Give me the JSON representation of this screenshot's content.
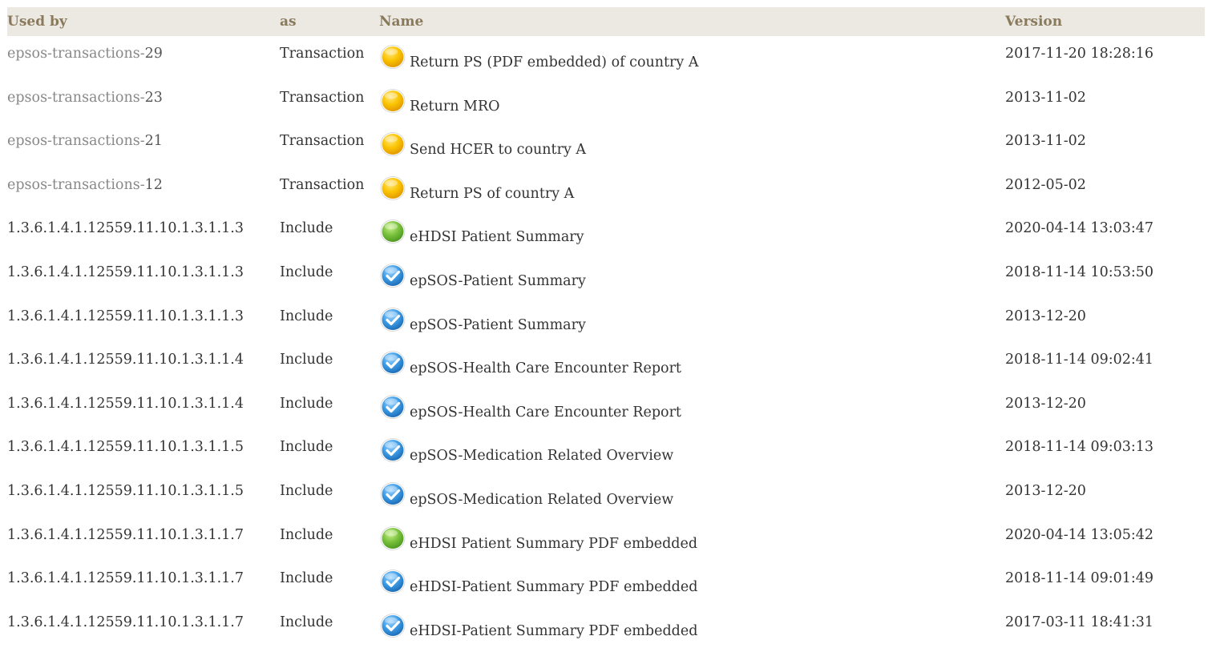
{
  "columns": {
    "used_by": "Used by",
    "as": "as",
    "name": "Name",
    "version": "Version"
  },
  "colors": {
    "header_bg": "#ece9e2",
    "header_text": "#8a7a5c",
    "link_text": "#888888",
    "status_draft": "#f7b500",
    "status_active": "#6fba3b",
    "status_final": "#3a9ee8"
  },
  "rows": [
    {
      "used_by_prefix": "epsos-transactions-",
      "used_by_num": "29",
      "as": "Transaction",
      "status_icon": "draft-status-icon",
      "name": "Return PS (PDF embedded) of country A",
      "version": "2017-11-20 18:28:16"
    },
    {
      "used_by_prefix": "epsos-transactions-",
      "used_by_num": "23",
      "as": "Transaction",
      "status_icon": "draft-status-icon",
      "name": "Return MRO",
      "version": "2013-11-02"
    },
    {
      "used_by_prefix": "epsos-transactions-",
      "used_by_num": "21",
      "as": "Transaction",
      "status_icon": "draft-status-icon",
      "name": "Send HCER to country A",
      "version": "2013-11-02"
    },
    {
      "used_by_prefix": "epsos-transactions-",
      "used_by_num": "12",
      "as": "Transaction",
      "status_icon": "draft-status-icon",
      "name": "Return PS of country A",
      "version": "2012-05-02"
    },
    {
      "used_by": "1.3.6.1.4.1.12559.11.10.1.3.1.1.3",
      "as": "Include",
      "status_icon": "active-status-icon",
      "name": "eHDSI Patient Summary",
      "version": "2020-04-14 13:03:47"
    },
    {
      "used_by": "1.3.6.1.4.1.12559.11.10.1.3.1.1.3",
      "as": "Include",
      "status_icon": "final-check-icon",
      "name": "epSOS-Patient Summary",
      "version": "2018-11-14 10:53:50"
    },
    {
      "used_by": "1.3.6.1.4.1.12559.11.10.1.3.1.1.3",
      "as": "Include",
      "status_icon": "final-check-icon",
      "name": "epSOS-Patient Summary",
      "version": "2013-12-20"
    },
    {
      "used_by": "1.3.6.1.4.1.12559.11.10.1.3.1.1.4",
      "as": "Include",
      "status_icon": "final-check-icon",
      "name": "epSOS-Health Care Encounter Report",
      "version": "2018-11-14 09:02:41"
    },
    {
      "used_by": "1.3.6.1.4.1.12559.11.10.1.3.1.1.4",
      "as": "Include",
      "status_icon": "final-check-icon",
      "name": "epSOS-Health Care Encounter Report",
      "version": "2013-12-20"
    },
    {
      "used_by": "1.3.6.1.4.1.12559.11.10.1.3.1.1.5",
      "as": "Include",
      "status_icon": "final-check-icon",
      "name": "epSOS-Medication Related Overview",
      "version": "2018-11-14 09:03:13"
    },
    {
      "used_by": "1.3.6.1.4.1.12559.11.10.1.3.1.1.5",
      "as": "Include",
      "status_icon": "final-check-icon",
      "name": "epSOS-Medication Related Overview",
      "version": "2013-12-20"
    },
    {
      "used_by": "1.3.6.1.4.1.12559.11.10.1.3.1.1.7",
      "as": "Include",
      "status_icon": "active-status-icon",
      "name": "eHDSI Patient Summary PDF embedded",
      "version": "2020-04-14 13:05:42"
    },
    {
      "used_by": "1.3.6.1.4.1.12559.11.10.1.3.1.1.7",
      "as": "Include",
      "status_icon": "final-check-icon",
      "name": "eHDSI-Patient Summary PDF embedded",
      "version": "2018-11-14 09:01:49"
    },
    {
      "used_by": "1.3.6.1.4.1.12559.11.10.1.3.1.1.7",
      "as": "Include",
      "status_icon": "final-check-icon",
      "name": "eHDSI-Patient Summary PDF embedded",
      "version": "2017-03-11 18:41:31"
    }
  ]
}
